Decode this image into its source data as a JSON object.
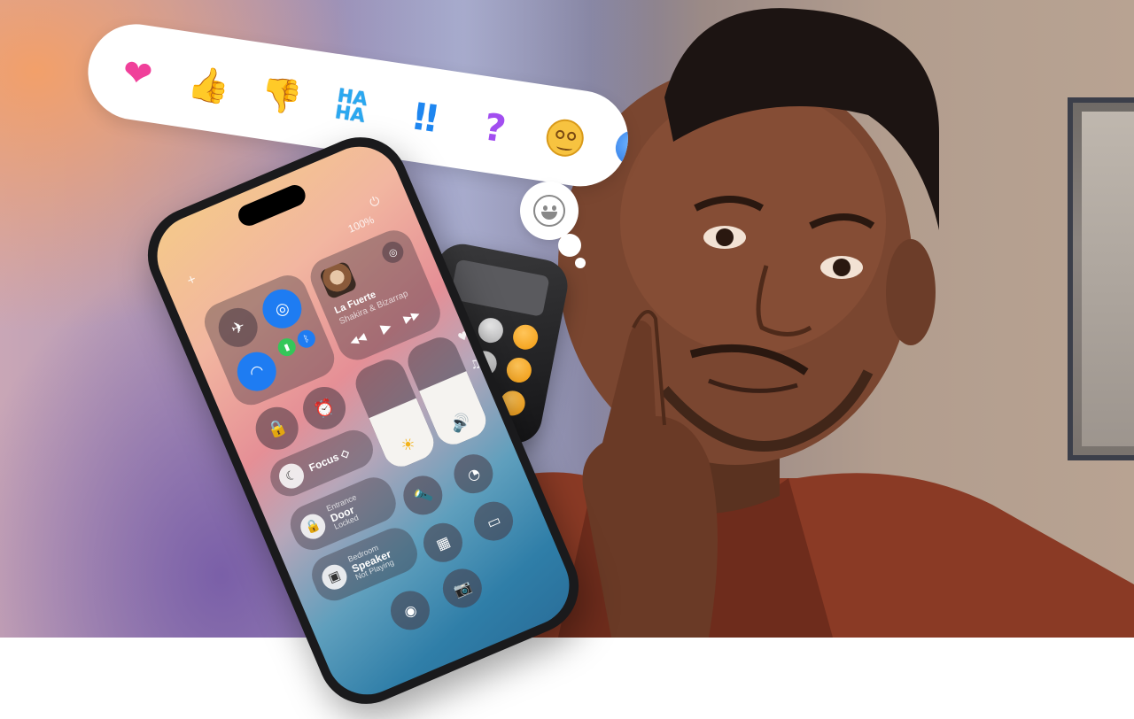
{
  "reactions": {
    "heart": "❤",
    "thumbs_up": "👍",
    "thumbs_down": "👎",
    "haha_line1": "HA",
    "haha_line2": "HA",
    "exclaim": "!!",
    "question": "?"
  },
  "phone": {
    "battery": "100%",
    "plus": "+",
    "power": "⏻",
    "media": {
      "title": "La Fuerte",
      "artist": "Shakira & Bizarrap",
      "prev": "◀◀",
      "play": "▶",
      "next": "▶▶"
    },
    "focus": {
      "label": "Focus ◇",
      "icon": "☾"
    },
    "door": {
      "room": "Entrance",
      "name": "Door",
      "state": "Locked",
      "icon": "🔒"
    },
    "speaker": {
      "room": "Bedroom",
      "name": "Speaker",
      "state": "Not Playing",
      "icon": "▣"
    },
    "icons": {
      "airplane": "✈",
      "airdrop": "◎",
      "wifi": "◠",
      "bluetooth": "ᛒ",
      "cellular": "▮",
      "alarm": "⏰",
      "rotation_lock": "🔒",
      "brightness": "☀",
      "volume": "🔊",
      "flashlight": "🔦",
      "timer": "◔",
      "screen_mirror": "▭",
      "calculator": "▦",
      "camera": "📷",
      "record": "◉",
      "heart": "♥",
      "music": "♫"
    }
  },
  "colors": {
    "heart": "#f0409a",
    "thumbs": "#f4b42a",
    "haha": "#2aa8f0",
    "exclaim": "#1e86f0",
    "question": "#a24ef0",
    "cc_blue": "#1e7cf2",
    "calc_orange": "#f29a0e"
  }
}
